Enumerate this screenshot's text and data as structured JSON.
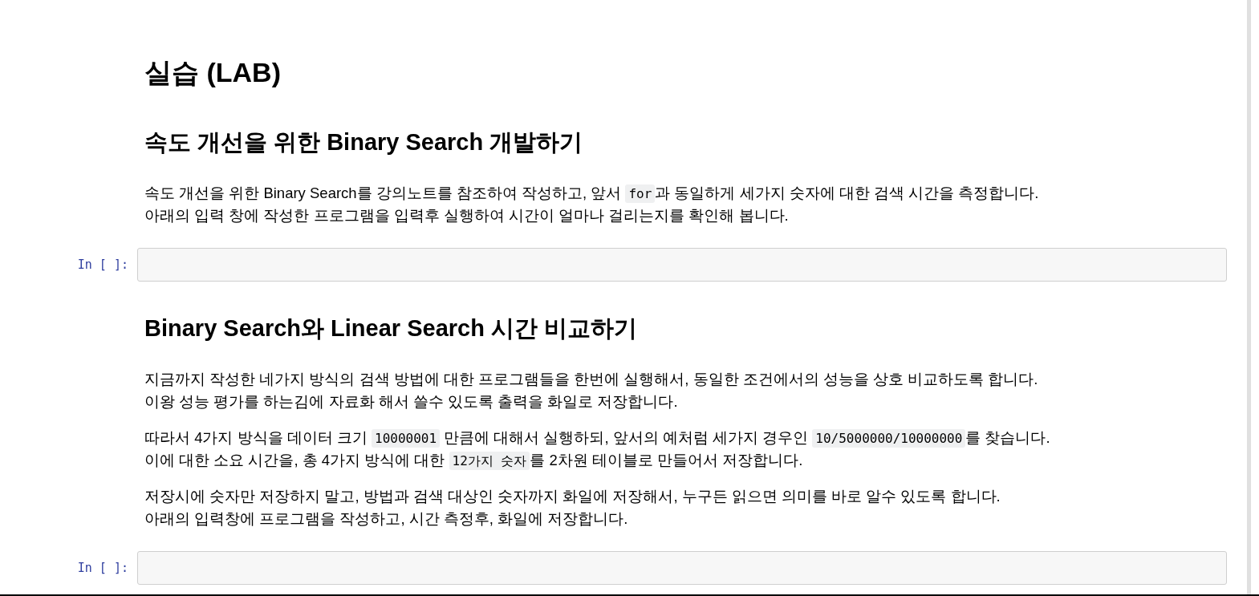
{
  "notebook": {
    "cells": [
      {
        "kind": "title",
        "text": "실습 (LAB)"
      },
      {
        "kind": "heading",
        "text": "속도 개선을 위한 Binary Search 개발하기"
      },
      {
        "kind": "paragraph",
        "lines": [
          [
            {
              "kind": "text",
              "text": "속도 개선을 위한 Binary Search를 강의노트를 참조하여 작성하고, 앞서 "
            },
            {
              "kind": "code",
              "text": "for"
            },
            {
              "kind": "text",
              "text": "과 동일하게 세가지 숫자에 대한 검색 시간을 측정합니다."
            }
          ],
          [
            {
              "kind": "text",
              "text": "아래의 입력 창에 작성한 프로그램을 입력후 실행하여 시간이 얼마나 걸리는지를 확인해 봅니다."
            }
          ]
        ]
      },
      {
        "kind": "code_cell",
        "prompt": "In [ ]:"
      },
      {
        "kind": "heading",
        "text": "Binary Search와 Linear Search 시간 비교하기"
      },
      {
        "kind": "paragraph",
        "lines": [
          [
            {
              "kind": "text",
              "text": "지금까지 작성한 네가지 방식의 검색 방법에 대한 프로그램들을 한번에 실행해서, 동일한 조건에서의 성능을 상호 비교하도록 합니다."
            }
          ],
          [
            {
              "kind": "text",
              "text": "이왕 성능 평가를 하는김에 자료화 해서 쓸수 있도록 출력을 화일로 저장합니다."
            }
          ]
        ]
      },
      {
        "kind": "paragraph",
        "lines": [
          [
            {
              "kind": "text",
              "text": "따라서 4가지 방식을 데이터 크기 "
            },
            {
              "kind": "code",
              "text": "10000001"
            },
            {
              "kind": "text",
              "text": " 만큼에 대해서 실행하되, 앞서의 예처럼 세가지 경우인 "
            },
            {
              "kind": "code",
              "text": "10/5000000/10000000"
            },
            {
              "kind": "text",
              "text": "를 찾습니다."
            }
          ],
          [
            {
              "kind": "text",
              "text": "이에 대한 소요 시간을, 총 4가지 방식에 대한 "
            },
            {
              "kind": "code",
              "text": "12가지 숫자"
            },
            {
              "kind": "text",
              "text": "를 2차원 테이블로 만들어서 저장합니다."
            }
          ]
        ]
      },
      {
        "kind": "paragraph",
        "lines": [
          [
            {
              "kind": "text",
              "text": "저장시에 숫자만 저장하지 말고, 방법과 검색 대상인 숫자까지 화일에 저장해서, 누구든 읽으면 의미를 바로 알수 있도록 합니다."
            }
          ],
          [
            {
              "kind": "text",
              "text": "아래의 입력창에 프로그램을 작성하고, 시간 측정후, 화일에 저장합니다."
            }
          ]
        ]
      },
      {
        "kind": "code_cell",
        "prompt": "In [ ]:"
      }
    ]
  }
}
